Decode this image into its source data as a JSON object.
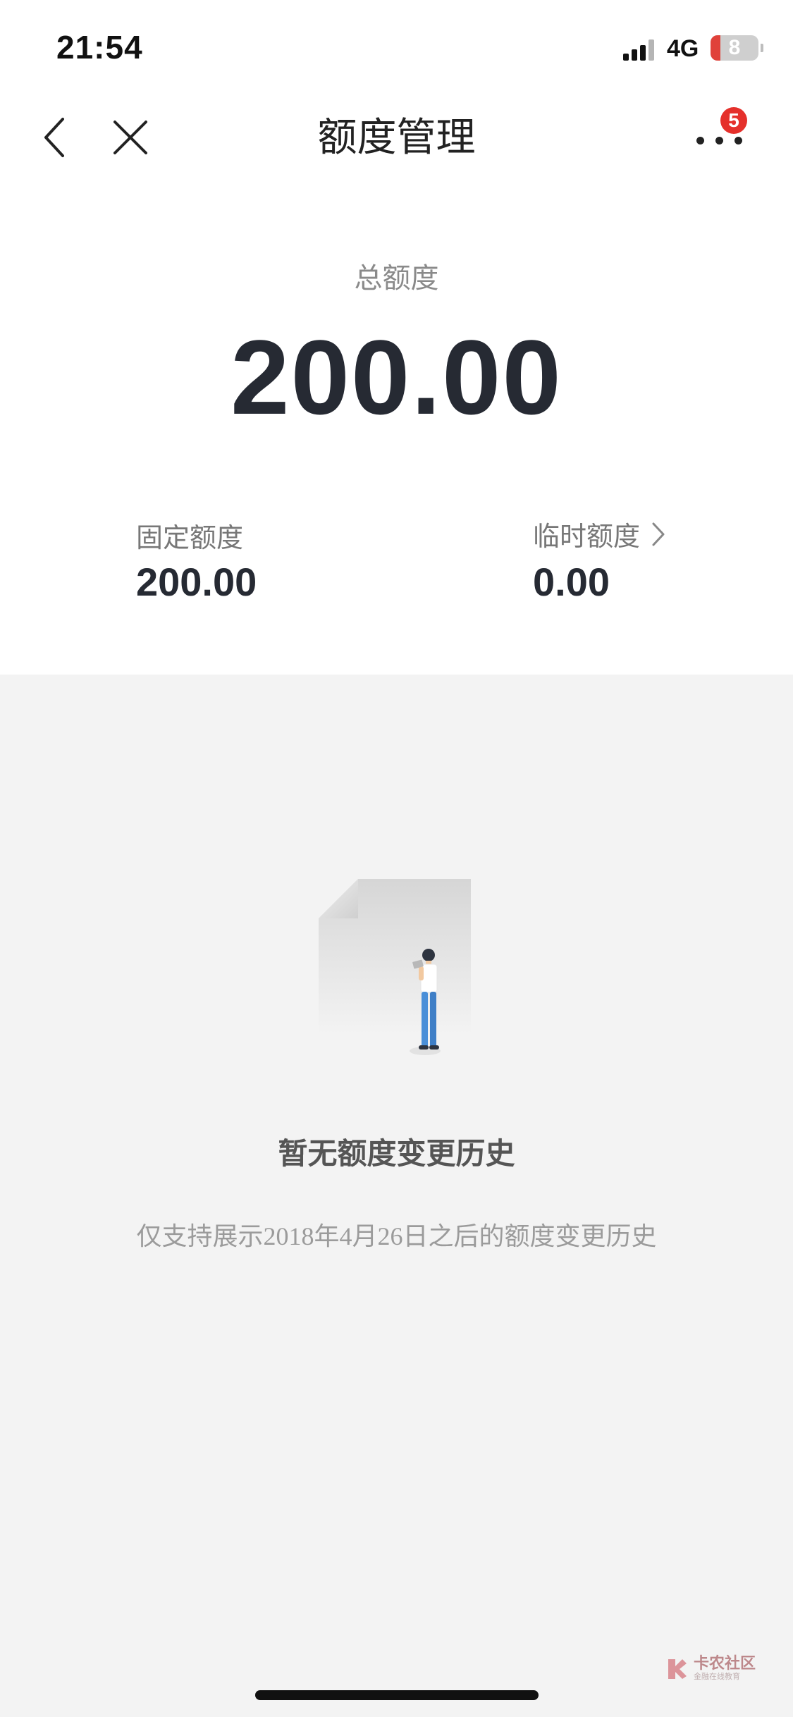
{
  "status_bar": {
    "time": "21:54",
    "network": "4G",
    "battery": "8"
  },
  "nav": {
    "title": "额度管理",
    "badge_count": "5"
  },
  "quota": {
    "total_label": "总额度",
    "total_value": "200.00",
    "fixed_label": "固定额度",
    "fixed_value": "200.00",
    "temp_label": "临时额度",
    "temp_value": "0.00"
  },
  "empty_state": {
    "title": "暂无额度变更历史",
    "description": "仅支持展示2018年4月26日之后的额度变更历史"
  },
  "watermark": {
    "name": "卡农社区",
    "subtitle": "金融在线教育"
  },
  "colors": {
    "text_primary": "#262a33",
    "badge": "#e5302b",
    "background_gray": "#f3f3f3",
    "illustration_blue": "#4a8fd8"
  },
  "icons": [
    "back-icon",
    "close-icon",
    "more-icon",
    "chevron-right-icon",
    "empty-document-icon",
    "watermark-logo-icon"
  ]
}
